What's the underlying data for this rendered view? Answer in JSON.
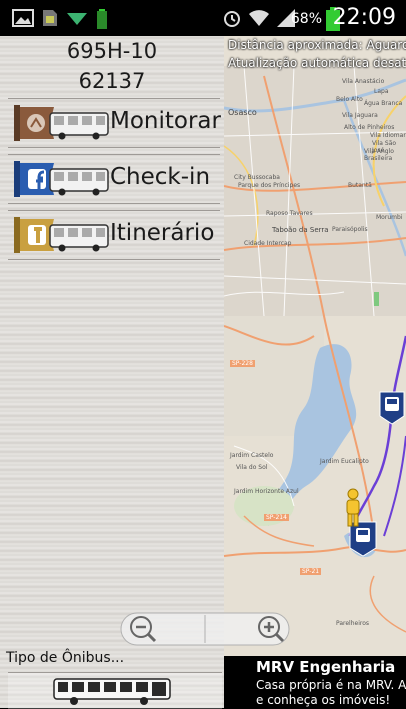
{
  "status_bar": {
    "battery_percent": "68%",
    "time": "22:09",
    "icons": [
      "gallery-icon",
      "sim-card-icon",
      "download-icon",
      "battery-small-icon",
      "alarm-icon",
      "wifi-icon",
      "signal-icon",
      "battery-icon"
    ]
  },
  "left_panel": {
    "line_code": "695H-10",
    "vehicle_id": "62137",
    "menu": [
      {
        "label": "Monitorar",
        "icon": "bus-monitor-icon",
        "color": "#8a5a3c"
      },
      {
        "label": "Check-in",
        "icon": "facebook-bus-icon",
        "color": "#2a5db0"
      },
      {
        "label": "Itinerário",
        "icon": "route-bus-icon",
        "color": "#c9a040"
      }
    ],
    "bus_type_label": "Tipo de Ônibus...",
    "bus_type_icon": "bus-side-icon"
  },
  "map": {
    "info_line1": "Distância aproximada: Aguard",
    "info_line2": "Atualização automática desat",
    "places": [
      "Vila Anastácio",
      "Lapa",
      "Belo Alto",
      "Água Branca",
      "Vila Jaguara",
      "Alto de Pinheiros",
      "Vila Idiomar",
      "Vila São José",
      "Vila Anglo Brasileira",
      "Osasco",
      "City Bussocaba",
      "Parque dos Príncipes",
      "Butantã",
      "Morumbi",
      "Raposo Tavares",
      "Taboão da Serra",
      "Paraisópolis",
      "Cidade Intercap",
      "Jardim Castelo",
      "Vila do Sol",
      "Jardim Eucalipto",
      "Jardim Horizonte Azul",
      "Parelheiros",
      "SP-228",
      "SP-214",
      "SP-21"
    ],
    "markers": [
      "bus-stop-marker-icon",
      "bus-stop-marker-icon",
      "pedestrian-icon"
    ]
  },
  "zoom": {
    "out_icon": "zoom-out-icon",
    "in_icon": "zoom-in-icon"
  },
  "ad": {
    "title": "MRV Engenharia",
    "line1": "Casa própria é na MRV. Ace",
    "line2": "e conheça os imóveis!"
  }
}
